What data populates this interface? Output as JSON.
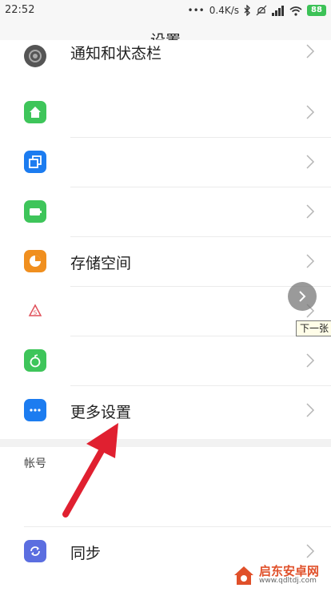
{
  "status_bar": {
    "time": "22:52",
    "speed": "0.4K/s",
    "battery": "88",
    "icons": [
      "bluetooth-icon",
      "mute-icon",
      "signal-icon",
      "wifi-icon"
    ]
  },
  "title_bar": {
    "title": "设置"
  },
  "rows": [
    {
      "name": "notification-status-bar",
      "label": "通知和状态栏",
      "icon": "gear-ring-icon",
      "color": "#555555"
    },
    {
      "name": "home-screen",
      "label": "",
      "icon": "home-icon",
      "color": "#3ec55a"
    },
    {
      "name": "multi-window",
      "label": "",
      "icon": "overlap-squares-icon",
      "color": "#1c7cf0"
    },
    {
      "name": "display",
      "label": "",
      "icon": "battery-rect-icon",
      "color": "#3ec55a"
    },
    {
      "name": "storage",
      "label": "存储空间",
      "icon": "pie-chart-icon",
      "color": "#f08f1f"
    },
    {
      "name": "security",
      "label": "",
      "icon": "shield-s-icon",
      "color": "#e0505a"
    },
    {
      "name": "power",
      "label": "",
      "icon": "bomb-icon",
      "color": "#3ec55a"
    },
    {
      "name": "more-settings",
      "label": "更多设置",
      "icon": "dots-icon",
      "color": "#1c7cf0"
    }
  ],
  "account_section": {
    "header": "帐号"
  },
  "sync_row": {
    "label": "同步",
    "icon": "sync-icon",
    "color": "#5b6ee0"
  },
  "overlay": {
    "next_tooltip": "下一张"
  },
  "watermark": {
    "cn": "启东安卓网",
    "url": "www.qdltdj.com"
  },
  "colors": {
    "arrow": "#e02030",
    "accent": "#3cc257"
  }
}
